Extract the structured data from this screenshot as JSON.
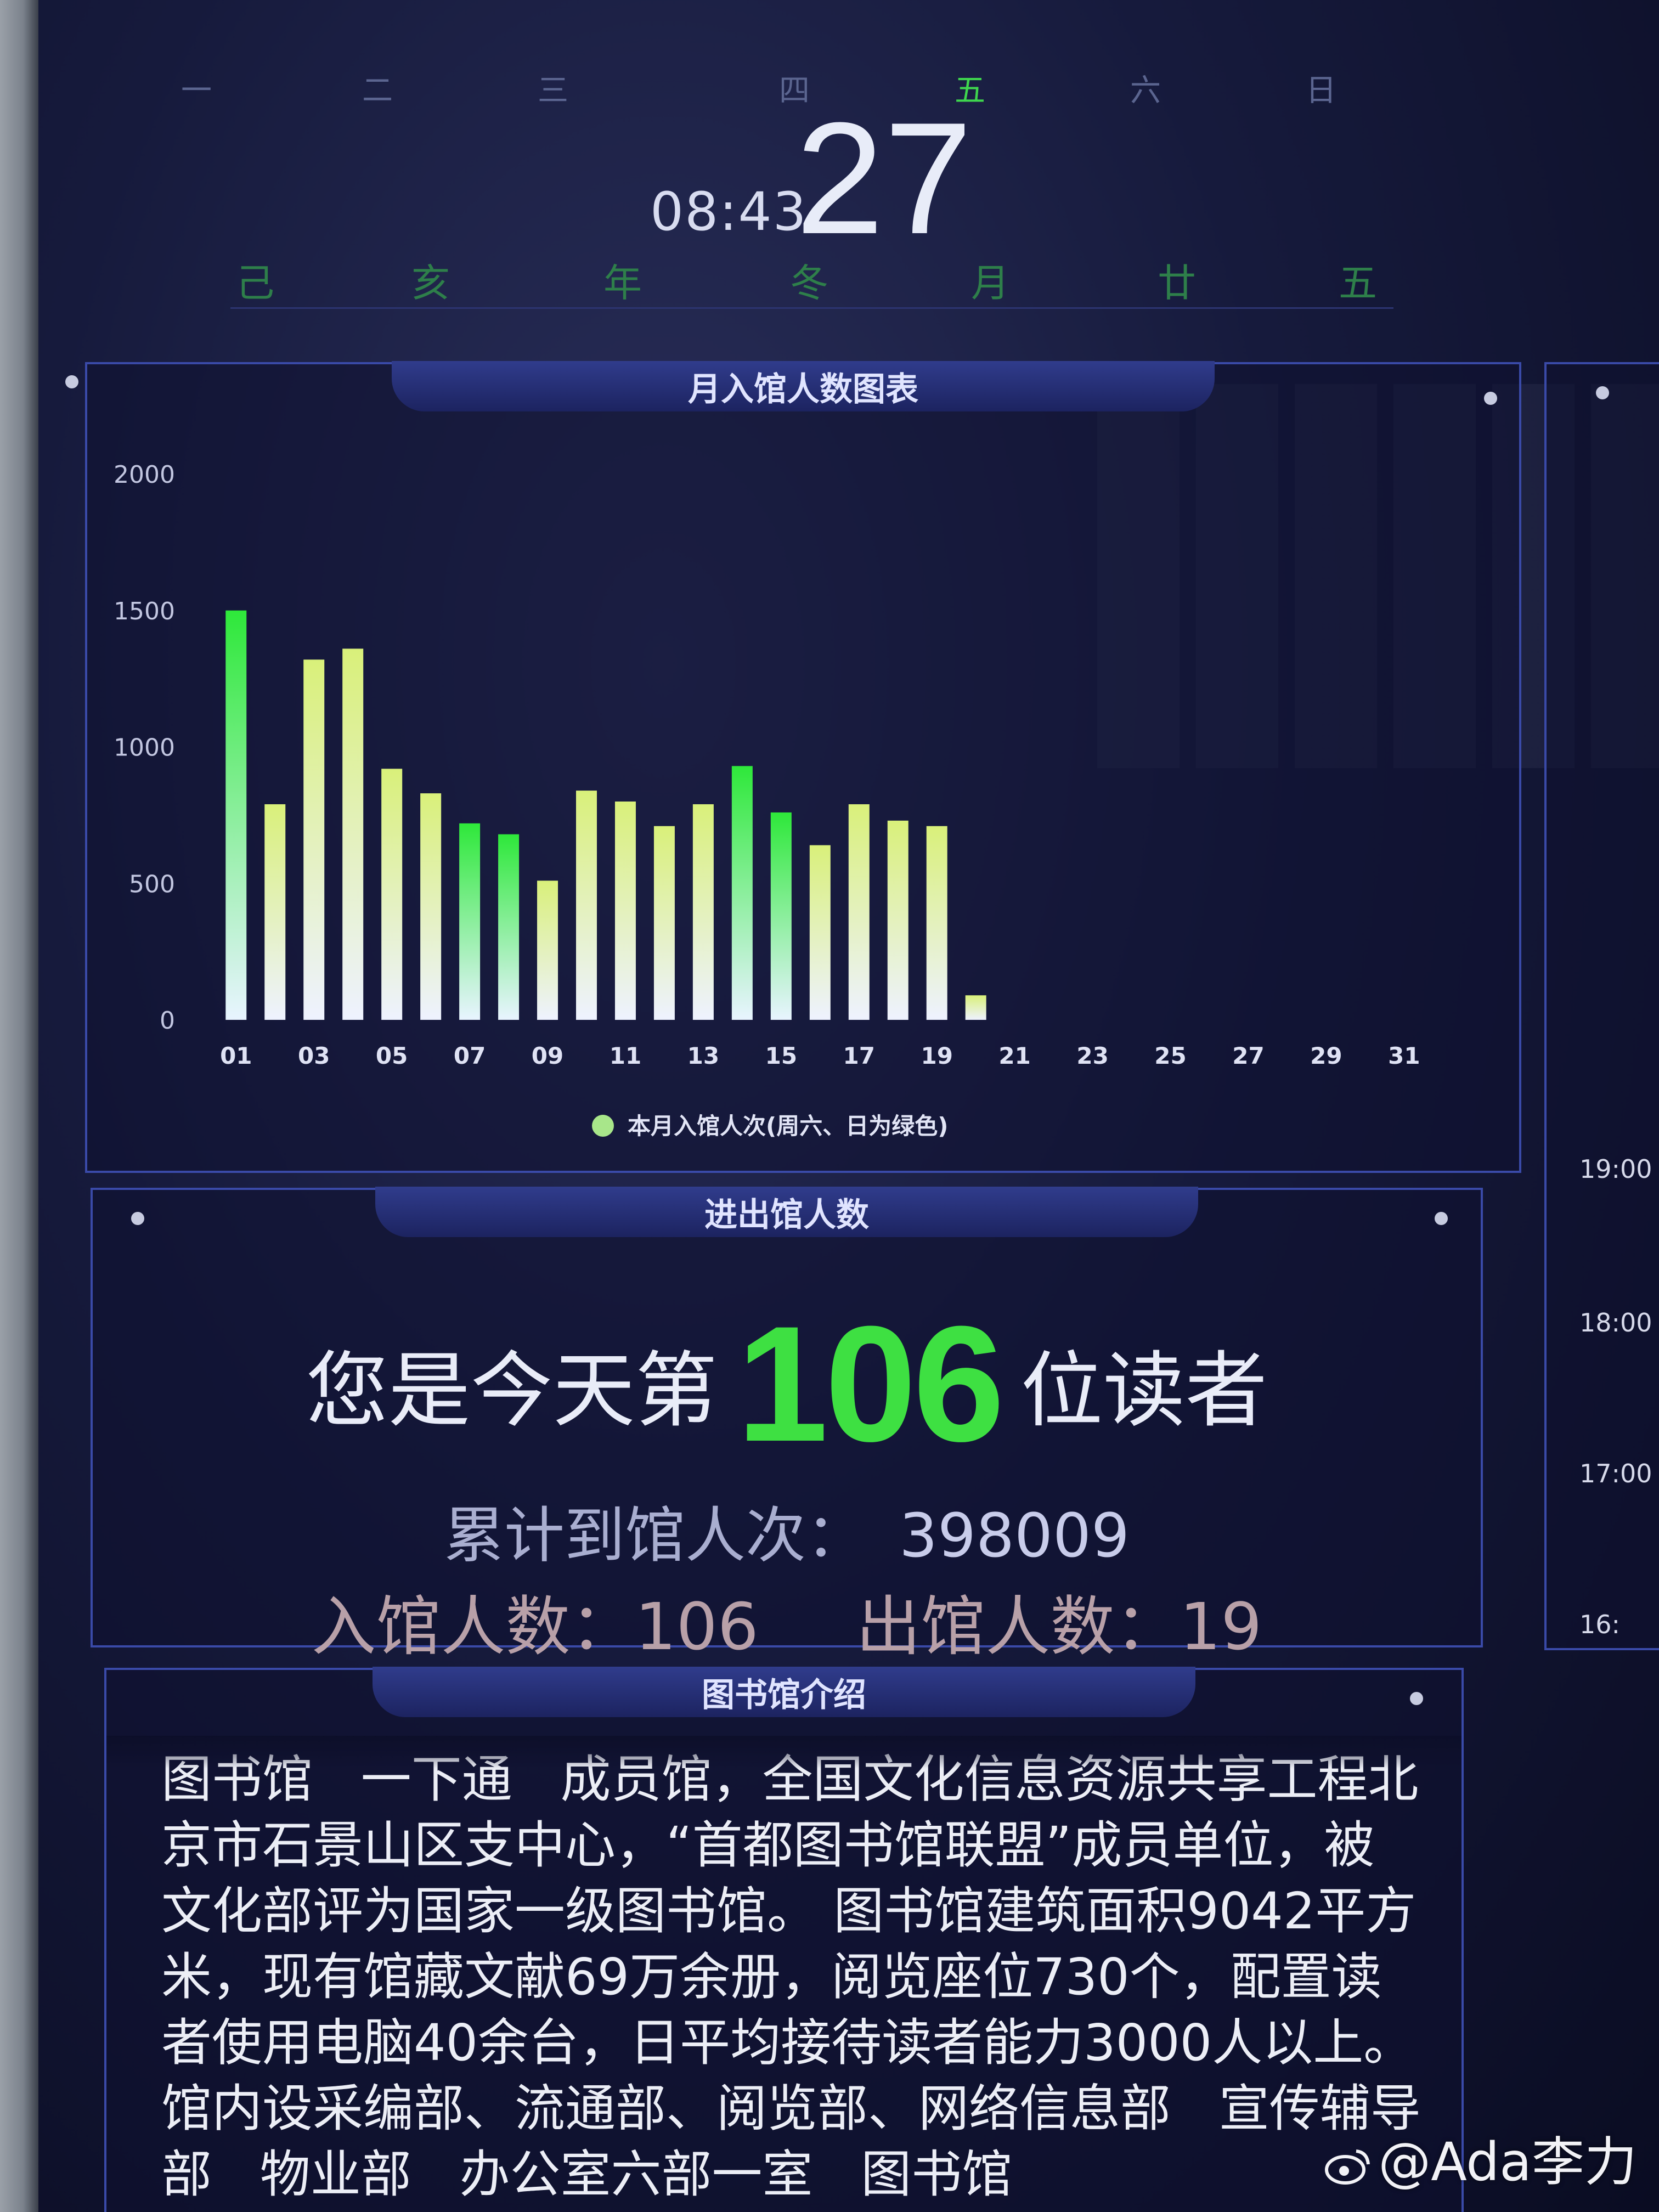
{
  "calendar": {
    "weekdays": [
      "一",
      "二",
      "三",
      "四",
      "五",
      "六",
      "日"
    ],
    "active_weekday_index": 4,
    "time": "08:43",
    "day": "27",
    "lunar": [
      "己",
      "亥",
      "年",
      "冬",
      "月",
      "廿",
      "五"
    ]
  },
  "chart_panel": {
    "title": "月入馆人数图表"
  },
  "chart_data": {
    "type": "bar",
    "categories": [
      "01",
      "02",
      "03",
      "04",
      "05",
      "06",
      "07",
      "08",
      "09",
      "10",
      "11",
      "12",
      "13",
      "14",
      "15",
      "16",
      "17",
      "18",
      "19",
      "20",
      "21",
      "22",
      "23",
      "24",
      "25",
      "26",
      "27",
      "28",
      "29",
      "30",
      "31"
    ],
    "x_tick_labels": [
      "01",
      "03",
      "05",
      "07",
      "09",
      "11",
      "13",
      "15",
      "17",
      "19",
      "21",
      "23",
      "25",
      "27",
      "29",
      "31"
    ],
    "series": [
      {
        "name": "本月入馆人次(周六、日为绿色)",
        "values": [
          1500,
          790,
          1320,
          1360,
          920,
          830,
          720,
          680,
          510,
          840,
          800,
          710,
          790,
          930,
          760,
          640,
          790,
          730,
          710,
          90,
          null,
          null,
          null,
          null,
          null,
          null,
          null,
          null,
          null,
          null,
          null
        ]
      }
    ],
    "weekend_days": [
      "01",
      "07",
      "08",
      "14",
      "15"
    ],
    "ylim": [
      0,
      2000
    ],
    "y_ticks": [
      "0",
      "500",
      "1000",
      "1500",
      "2000"
    ],
    "colors": {
      "weekday_top": "#d9f07a",
      "weekday_bottom": "#eef2ff",
      "weekend_top": "#2ee83a",
      "weekend_bottom": "#e8f4ff",
      "legend_dot": "#a8e68a"
    },
    "legend_position": "bottom-center"
  },
  "visitors_panel": {
    "title": "进出馆人数",
    "welcome_pre": "您是今天第",
    "welcome_num": "106",
    "welcome_post": "位读者",
    "cumulative_label": "累计到馆人次：",
    "cumulative_value": "398009",
    "in_label": "入馆人数：106",
    "out_label": "出馆人数：19"
  },
  "intro_panel": {
    "title": "图书馆介绍",
    "text": "图书馆   一下通   成员馆，全国文化信息资源共享工程北京市石景山区支中心，“首都图书馆联盟”成员单位，被文化部评为国家一级图书馆。 图书馆建筑面积9042平方米，现有馆藏文献69万余册，阅览座位730个，配置读者使用电脑40余台，日平均接待读者能力3000人以上。馆内设采编部、流通部、阅览部、网络信息部   宣传辅导部   物业部   办公室六部一室   图书馆"
  },
  "side_panel": {
    "times": [
      "19:00",
      "18:00",
      "17:00",
      "16:"
    ]
  },
  "watermark": "@Ada李力"
}
